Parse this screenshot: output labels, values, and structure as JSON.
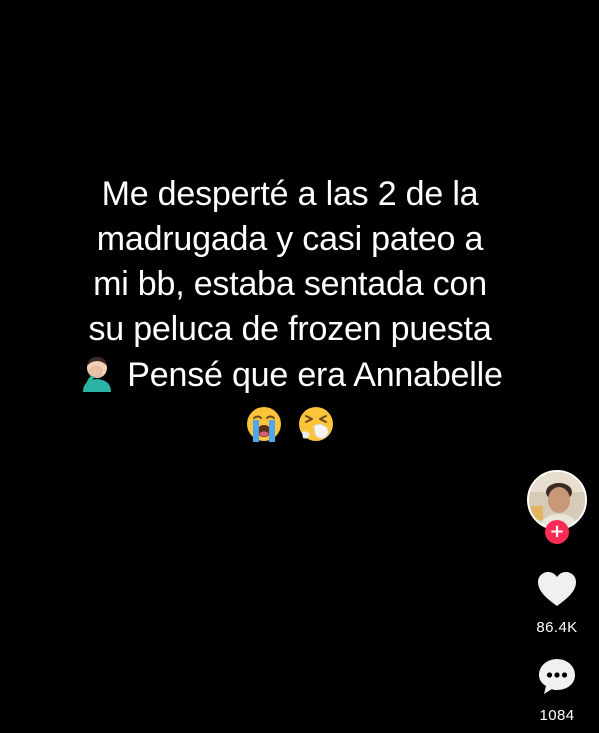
{
  "post": {
    "caption_lines": [
      "Me desperté a las 2 de la",
      "madrugada y casi pateo  a",
      "mi bb, estaba sentada con",
      "su peluca de frozen puesta",
      "Pensé que era Annabelle"
    ],
    "caption_emojis": {
      "facepalm": "🤦🏻‍♂️",
      "crying": "😭",
      "sneezing": "🤧"
    }
  },
  "sidebar": {
    "avatar_icon": "profile-avatar",
    "follow_label": "+",
    "likes": {
      "icon": "heart-icon",
      "count": "86.4K"
    },
    "comments": {
      "icon": "comment-icon",
      "count": "1084"
    }
  },
  "colors": {
    "background": "#000000",
    "text": "#ffffff",
    "follow_badge": "#fe2c55"
  }
}
